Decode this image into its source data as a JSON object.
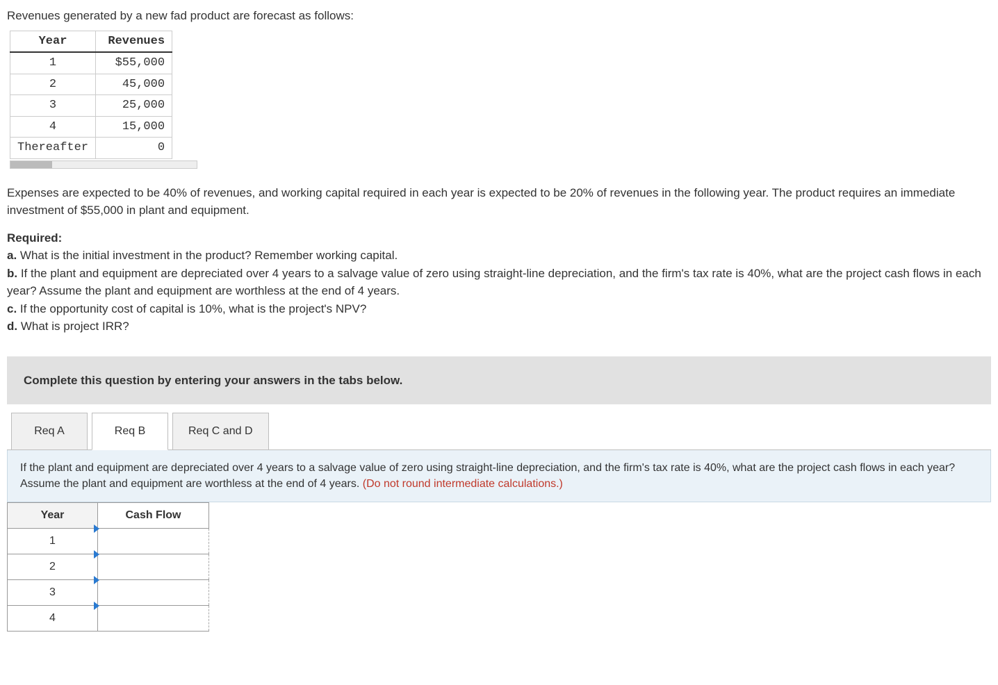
{
  "intro": "Revenues generated by a new fad product are forecast as follows:",
  "revenue_table": {
    "headers": {
      "year": "Year",
      "rev": "Revenues"
    },
    "rows": [
      {
        "year": "1",
        "rev": "$55,000"
      },
      {
        "year": "2",
        "rev": "45,000"
      },
      {
        "year": "3",
        "rev": "25,000"
      },
      {
        "year": "4",
        "rev": "15,000"
      },
      {
        "year": "Thereafter",
        "rev": "0"
      }
    ]
  },
  "paragraph2": "Expenses are expected to be 40% of revenues, and working capital required in each year is expected to be 20% of revenues in the following year. The product requires an immediate investment of $55,000 in plant and equipment.",
  "required": {
    "heading": "Required:",
    "a_label": "a.",
    "a_text": " What is the initial investment in the product? Remember working capital.",
    "b_label": "b.",
    "b_text": " If the plant and equipment are depreciated over 4 years to a salvage value of zero using straight-line depreciation, and the firm's tax rate is 40%, what are the project cash flows in each year? Assume the plant  and equipment are worthless at the end of 4 years.",
    "c_label": "c.",
    "c_text": " If the opportunity cost of capital is 10%, what is the project's NPV?",
    "d_label": "d.",
    "d_text": " What is project IRR?"
  },
  "prompt_bar": "Complete this question by entering your answers in the tabs below.",
  "tabs": {
    "a": "Req A",
    "b": "Req B",
    "cd": "Req C and D"
  },
  "tab_b_instruction_main": "If the plant and equipment are depreciated over 4 years to a salvage value of zero using straight-line depreciation, and the firm's tax rate is 40%, what are the project cash flows in each year? Assume the plant and equipment are worthless at the end of 4 years. ",
  "tab_b_instruction_red": "(Do not round intermediate calculations.)",
  "cashflow_table": {
    "headers": {
      "year": "Year",
      "cash": "Cash Flow"
    },
    "rows": [
      {
        "year": "1"
      },
      {
        "year": "2"
      },
      {
        "year": "3"
      },
      {
        "year": "4"
      }
    ]
  }
}
